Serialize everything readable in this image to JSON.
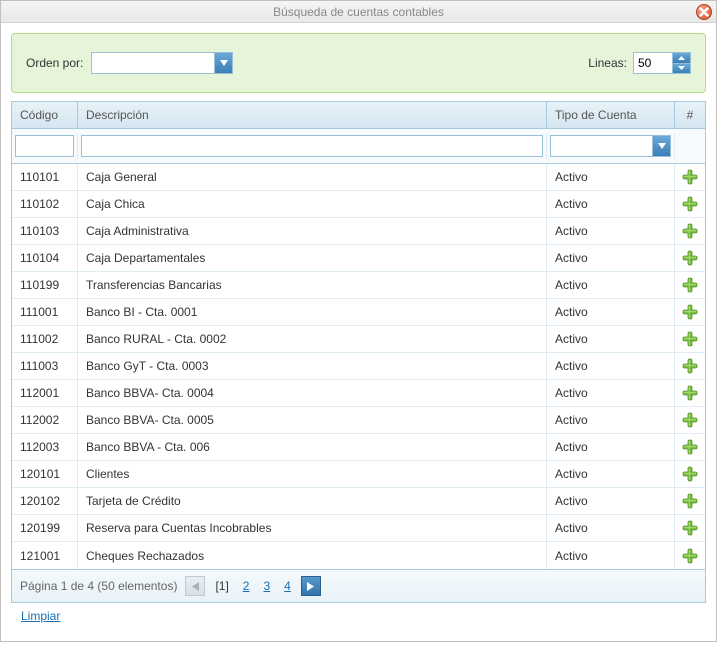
{
  "window": {
    "title": "Búsqueda de cuentas contables"
  },
  "filter": {
    "orden_por_label": "Orden por:",
    "orden_por_value": "",
    "lineas_label": "Lineas:",
    "lineas_value": "50"
  },
  "columns": {
    "codigo": "Código",
    "descripcion": "Descripción",
    "tipo": "Tipo de Cuenta",
    "action": "#"
  },
  "filter_row": {
    "codigo": "",
    "descripcion": "",
    "tipo": ""
  },
  "rows": [
    {
      "codigo": "110101",
      "descripcion": "Caja General",
      "tipo": "Activo"
    },
    {
      "codigo": "110102",
      "descripcion": "Caja Chica",
      "tipo": "Activo"
    },
    {
      "codigo": "110103",
      "descripcion": "Caja Administrativa",
      "tipo": "Activo"
    },
    {
      "codigo": "110104",
      "descripcion": "Caja Departamentales",
      "tipo": "Activo"
    },
    {
      "codigo": "110199",
      "descripcion": "Transferencias Bancarias",
      "tipo": "Activo"
    },
    {
      "codigo": "111001",
      "descripcion": "Banco BI - Cta. 0001",
      "tipo": "Activo"
    },
    {
      "codigo": "111002",
      "descripcion": "Banco RURAL - Cta. 0002",
      "tipo": "Activo"
    },
    {
      "codigo": "111003",
      "descripcion": "Banco GyT - Cta. 0003",
      "tipo": "Activo"
    },
    {
      "codigo": "112001",
      "descripcion": "Banco BBVA- Cta. 0004",
      "tipo": "Activo"
    },
    {
      "codigo": "112002",
      "descripcion": "Banco BBVA- Cta. 0005",
      "tipo": "Activo"
    },
    {
      "codigo": "112003",
      "descripcion": "Banco BBVA - Cta. 006",
      "tipo": "Activo"
    },
    {
      "codigo": "120101",
      "descripcion": "Clientes",
      "tipo": "Activo"
    },
    {
      "codigo": "120102",
      "descripcion": "Tarjeta de Crédito",
      "tipo": "Activo"
    },
    {
      "codigo": "120199",
      "descripcion": "Reserva para Cuentas Incobrables",
      "tipo": "Activo"
    },
    {
      "codigo": "121001",
      "descripcion": "Cheques Rechazados",
      "tipo": "Activo"
    }
  ],
  "pager": {
    "summary": "Página 1 de 4 (50 elementos)",
    "pages": [
      "[1]",
      "2",
      "3",
      "4"
    ],
    "current_index": 0
  },
  "footer": {
    "limpiar": "Limpiar"
  }
}
